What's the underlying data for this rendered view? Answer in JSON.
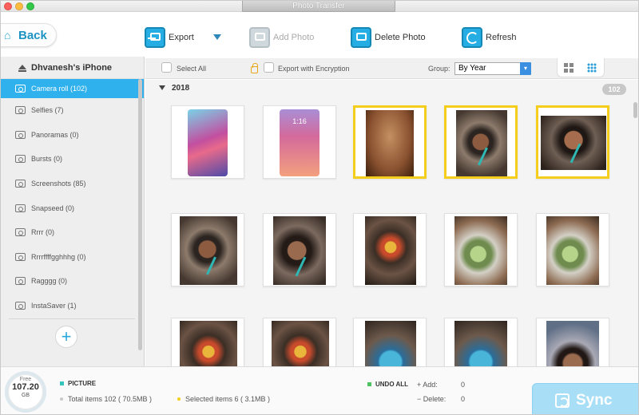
{
  "window": {
    "title": "Photo Transfer"
  },
  "toolbar": {
    "back_label": "Back",
    "export_label": "Export",
    "add_photo_label": "Add Photo",
    "delete_photo_label": "Delete Photo",
    "refresh_label": "Refresh"
  },
  "sidebar": {
    "device_name": "Dhvanesh's iPhone",
    "albums": [
      {
        "label": "Camera roll (102)",
        "selected": true
      },
      {
        "label": "Selfies (7)"
      },
      {
        "label": "Panoramas (0)"
      },
      {
        "label": "Bursts (0)"
      },
      {
        "label": "Screenshots (85)"
      },
      {
        "label": "Snapseed (0)"
      },
      {
        "label": "Rrrr (0)"
      },
      {
        "label": "Rrrrffffgghhhg (0)"
      },
      {
        "label": "Ragggg (0)"
      },
      {
        "label": "InstaSaver (1)"
      }
    ],
    "add_icon": "plus-icon"
  },
  "options": {
    "select_all_label": "Select All",
    "export_encryption_label": "Export with Encryption",
    "group_label": "Group:",
    "group_value": "By Year"
  },
  "content": {
    "year": "2018",
    "count": "102",
    "phone_time": "1:16",
    "thumbnails": [
      {
        "kind": "phone-home",
        "selected": false
      },
      {
        "kind": "phone-lock",
        "selected": false
      },
      {
        "kind": "blur",
        "selected": true
      },
      {
        "kind": "selfie-blur",
        "selected": true
      },
      {
        "kind": "selfie-straw",
        "selected": true
      },
      {
        "kind": "selfie-blur",
        "selected": false
      },
      {
        "kind": "selfie-straw",
        "selected": false
      },
      {
        "kind": "food-skewers",
        "selected": false
      },
      {
        "kind": "drink",
        "selected": false
      },
      {
        "kind": "drink",
        "selected": false
      },
      {
        "kind": "food-skewers",
        "selected": false
      },
      {
        "kind": "food-skewers",
        "selected": false
      },
      {
        "kind": "blue-drink",
        "selected": false
      },
      {
        "kind": "blue-drink",
        "selected": false
      },
      {
        "kind": "face-restaurant",
        "selected": false
      }
    ]
  },
  "footer": {
    "free_label": "Free",
    "free_value": "107.20",
    "free_unit": "GB",
    "picture_label": "PICTURE",
    "total_text": "Total items 102 ( 70.5MB )",
    "selected_text": "Selected items 6 ( 3.1MB )",
    "undo_label": "UNDO ALL",
    "add_label": "+ Add:",
    "add_value": "0",
    "delete_label": "− Delete:",
    "delete_value": "0",
    "sync_label": "Sync"
  },
  "colors": {
    "accent": "#2eb1ec",
    "selection": "#f5cd1c",
    "picture_legend": "#35c4bd",
    "undo_legend": "#4cc35c",
    "selected_dot": "#f5cd1c",
    "total_dot": "#c8c8c8"
  }
}
